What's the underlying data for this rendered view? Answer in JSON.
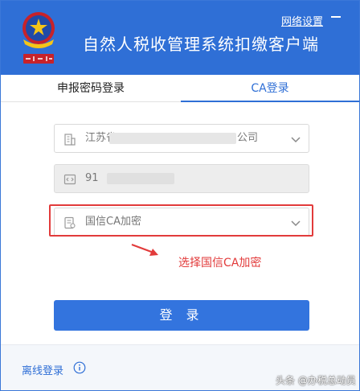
{
  "header": {
    "app_title": "自然人税收管理系统扣缴客户端",
    "network_settings": "网络设置"
  },
  "tabs": [
    {
      "label": "申报密码登录"
    },
    {
      "label": "CA登录"
    }
  ],
  "form": {
    "company_prefix": "江苏省",
    "company_suffix": "公司",
    "tax_id_prefix": "91",
    "ca_select": "国信CA加密"
  },
  "annotation": {
    "text": "选择国信CA加密"
  },
  "login_button": "登 录",
  "footer": {
    "offline_login": "离线登录",
    "watermark": "头条 @办税总动员"
  },
  "colors": {
    "brand": "#2f6fd6",
    "annotation": "#e23b3b"
  }
}
